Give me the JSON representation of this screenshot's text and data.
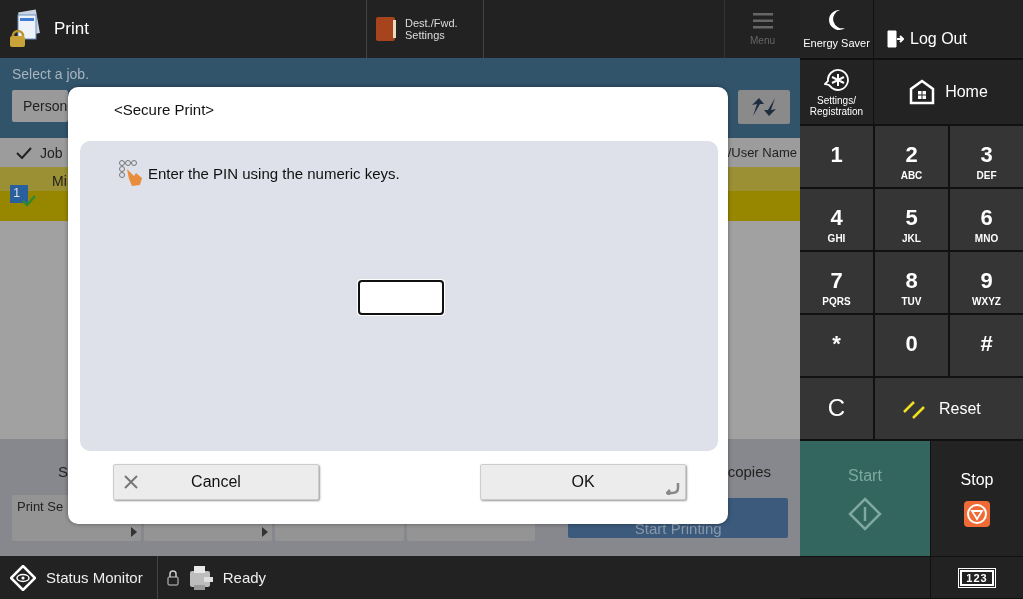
{
  "header": {
    "title": "Print",
    "dest_button": {
      "lines": [
        "Dest./Fwd.",
        "Settings"
      ]
    },
    "menu": {
      "label": "Menu",
      "disabled": true
    }
  },
  "job_area": {
    "instruction": "Select a job.",
    "filter_button": "Person",
    "columns": [
      "Job",
      "/User Name"
    ],
    "rows": [
      {
        "number": "1",
        "name": "Mi",
        "selected": true
      }
    ]
  },
  "bottom": {
    "label": "S",
    "buttons": [
      {
        "label": "Print Se",
        "arrow": true
      },
      {
        "arrow": true
      },
      {
        "arrow": false
      },
      {
        "arrow": false
      }
    ],
    "copies": "copies",
    "start_printing": "Start Printing"
  },
  "status_bar": {
    "monitor": "Status Monitor",
    "status": "Ready"
  },
  "side": {
    "energy_saver": "Energy Saver",
    "log_out": "Log Out",
    "settings": [
      "Settings/",
      "Registration"
    ],
    "home": "Home",
    "keys": [
      {
        "main": "1"
      },
      {
        "main": "2",
        "sub": "ABC"
      },
      {
        "main": "3",
        "sub": "DEF"
      },
      {
        "main": "4",
        "sub": "GHI"
      },
      {
        "main": "5",
        "sub": "JKL"
      },
      {
        "main": "6",
        "sub": "MNO"
      },
      {
        "main": "7",
        "sub": "PQRS"
      },
      {
        "main": "8",
        "sub": "TUV"
      },
      {
        "main": "9",
        "sub": "WXYZ"
      },
      {
        "main": "*"
      },
      {
        "main": "0"
      },
      {
        "main": "#"
      }
    ],
    "clear": "C",
    "reset": "Reset",
    "start": {
      "label": "Start",
      "disabled": true
    },
    "stop": "Stop",
    "keypad_toggle": "123"
  },
  "dialog": {
    "title": "<Secure Print>",
    "message": "Enter the PIN using the numeric keys.",
    "pin_field": {
      "focused": true
    },
    "cancel": "Cancel",
    "ok": "OK"
  }
}
